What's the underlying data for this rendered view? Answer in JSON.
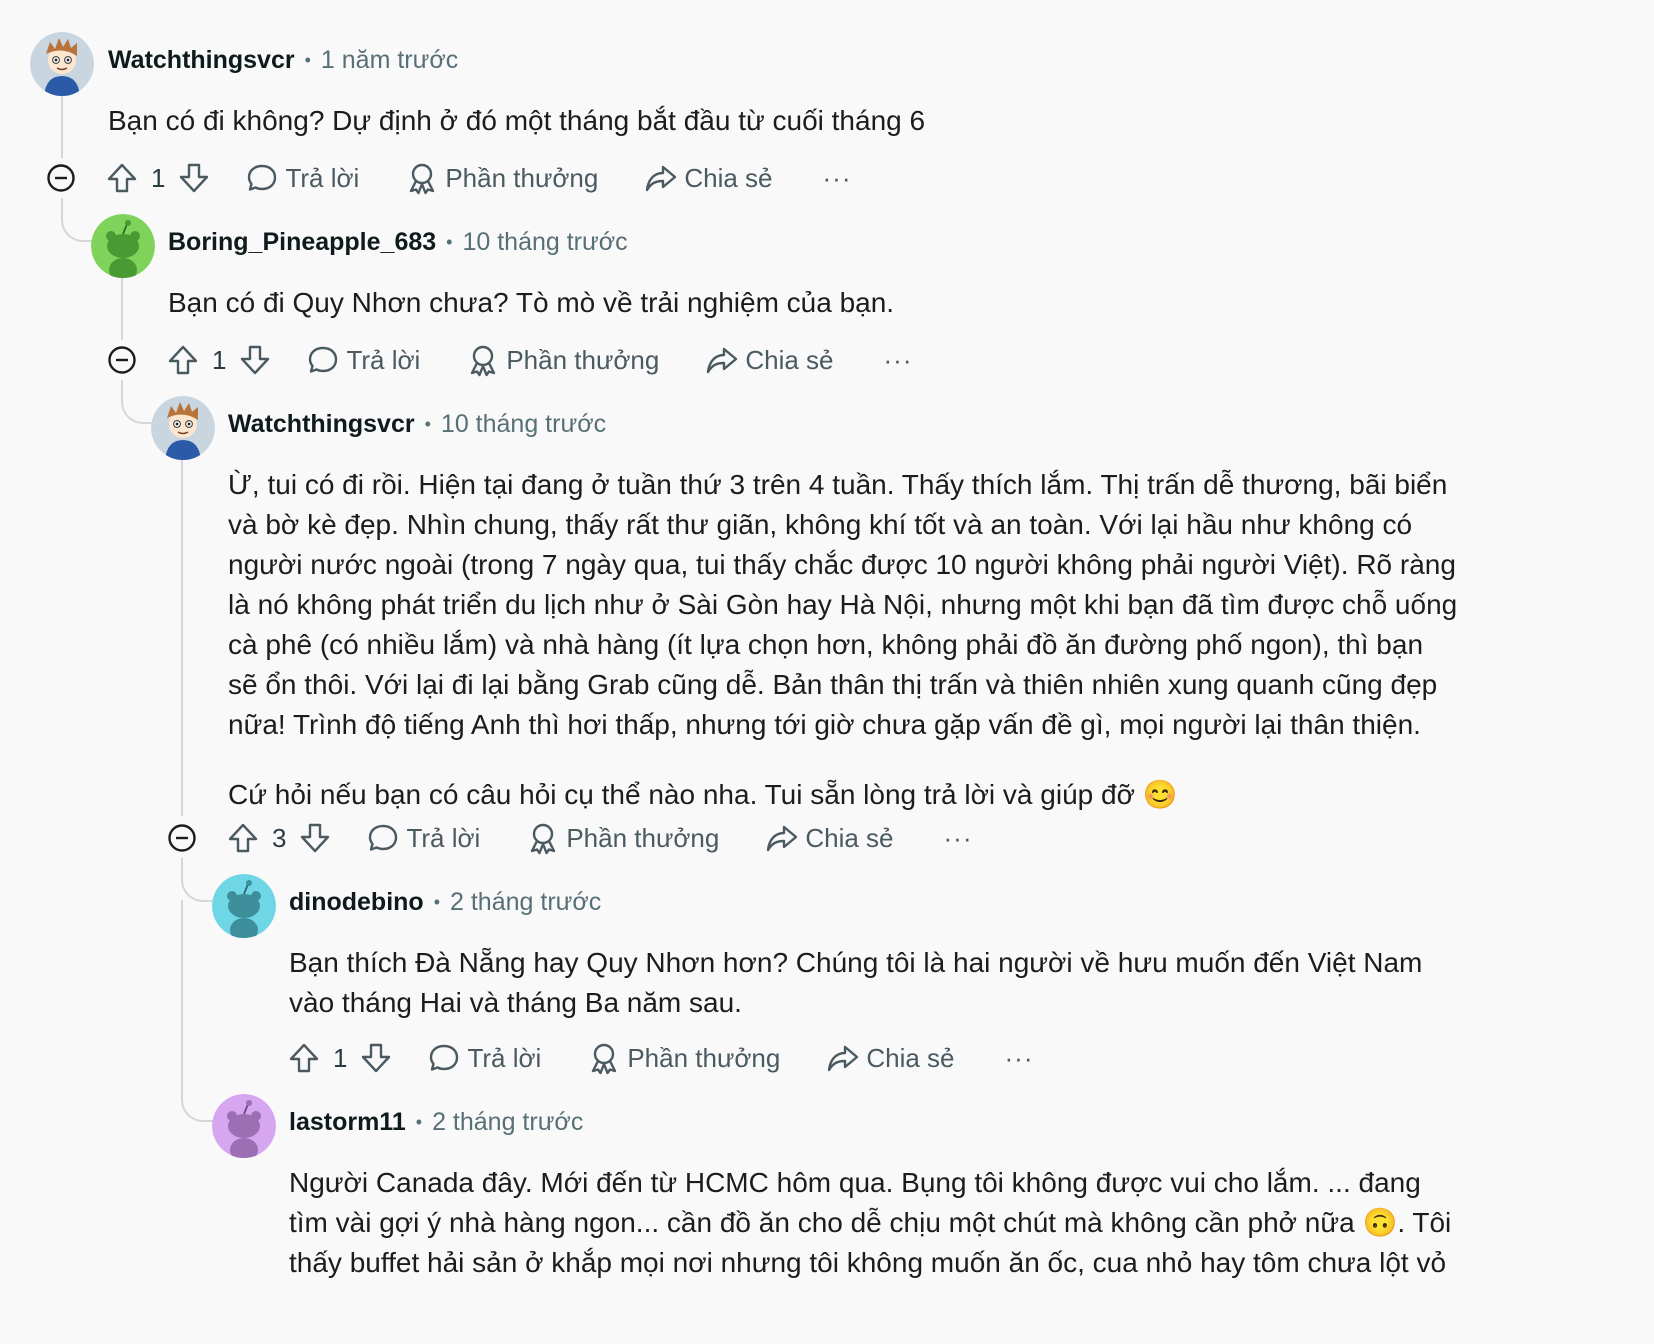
{
  "comments": [
    {
      "user": "Watchthingsvcr",
      "time": "1 năm trước",
      "avatar_color": "#c9d6df",
      "avatar_icon": "cartoon-avatar",
      "body": [
        "Bạn có đi không? Dự định ở đó một tháng bắt đầu từ cuối tháng 6"
      ],
      "score": "1"
    },
    {
      "user": "Boring_Pineapple_683",
      "time": "10 tháng trước",
      "avatar_color": "#7fd35a",
      "avatar_icon": "snoo-avatar",
      "body": [
        "Bạn có đi Quy Nhơn chưa? Tò mò về trải nghiệm của bạn."
      ],
      "score": "1"
    },
    {
      "user": "Watchthingsvcr",
      "time": "10 tháng trước",
      "avatar_color": "#c9d6df",
      "avatar_icon": "cartoon-avatar",
      "body": [
        "Ừ, tui có đi rồi. Hiện tại đang ở tuần thứ 3 trên 4 tuần. Thấy thích lắm. Thị trấn dễ thương, bãi biển và bờ kè đẹp. Nhìn chung, thấy rất thư giãn, không khí tốt và an toàn. Với lại hầu như không có người nước ngoài (trong 7 ngày qua, tui thấy chắc được 10 người không phải người Việt). Rõ ràng là nó không phát triển du lịch như ở Sài Gòn hay Hà Nội, nhưng một khi bạn đã tìm được chỗ uống cà phê (có nhiều lắm) và nhà hàng (ít lựa chọn hơn, không phải đồ ăn đường phố ngon), thì bạn sẽ ổn thôi. Với lại đi lại bằng Grab cũng dễ. Bản thân thị trấn và thiên nhiên xung quanh cũng đẹp nữa! Trình độ tiếng Anh thì hơi thấp, nhưng tới giờ chưa gặp vấn đề gì, mọi người lại thân thiện.",
        "Cứ hỏi nếu bạn có câu hỏi cụ thể nào nha. Tui sẵn lòng trả lời và giúp đỡ 😊"
      ],
      "score": "3"
    },
    {
      "user": "dinodebino",
      "time": "2 tháng trước",
      "avatar_color": "#6fd6e6",
      "avatar_icon": "snoo-avatar",
      "body": [
        "Bạn thích Đà Nẵng hay Quy Nhơn hơn? Chúng tôi là hai người về hưu muốn đến Việt Nam vào tháng Hai và tháng Ba năm sau."
      ],
      "score": "1"
    },
    {
      "user": "lastorm11",
      "time": "2 tháng trước",
      "avatar_color": "#d7a6f0",
      "avatar_icon": "snoo-avatar",
      "body": [
        "Người Canada đây. Mới đến từ HCMC hôm qua. Bụng tôi không được vui cho lắm. ... đang tìm vài gợi ý nhà hàng ngon... cần đồ ăn cho dễ chịu một chút mà không cần phở nữa 🙃. Tôi thấy buffet hải sản ở khắp mọi nơi nhưng tôi không muốn ăn ốc, cua nhỏ hay tôm chưa lột vỏ"
      ]
    }
  ],
  "actions": {
    "reply": "Trả lời",
    "award": "Phần thưởng",
    "share": "Chia sẻ",
    "more": "···"
  },
  "colors": {
    "background": "#f9f9fa",
    "thread_line": "#d4d7d9",
    "muted_text": "#576f76"
  }
}
